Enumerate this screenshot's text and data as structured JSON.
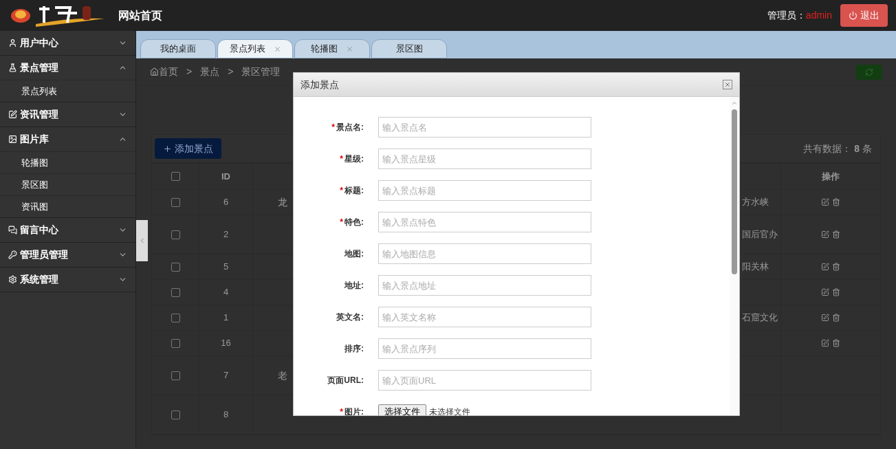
{
  "header": {
    "title": "网站首页",
    "admin_label": "管理员：",
    "admin_name": "admin",
    "logout": "退出"
  },
  "sidebar": [
    {
      "label": "用户中心",
      "expanded": false
    },
    {
      "label": "景点管理",
      "expanded": true,
      "children": [
        {
          "label": "景点列表"
        }
      ]
    },
    {
      "label": "资讯管理",
      "expanded": false
    },
    {
      "label": "图片库",
      "expanded": true,
      "children": [
        {
          "label": "轮播图"
        },
        {
          "label": "景区图"
        },
        {
          "label": "资讯图"
        }
      ]
    },
    {
      "label": "留言中心",
      "expanded": false
    },
    {
      "label": "管理员管理",
      "expanded": false
    },
    {
      "label": "系统管理",
      "expanded": false
    }
  ],
  "tabs": [
    {
      "label": "我的桌面",
      "selected": false,
      "closable": false
    },
    {
      "label": "景点列表",
      "selected": true,
      "closable": true
    },
    {
      "label": "轮播图",
      "selected": false,
      "closable": true
    },
    {
      "label": "景区图",
      "selected": false,
      "closable": false
    }
  ],
  "breadcrumb": {
    "items": [
      "首页",
      "景点",
      "景区管理"
    ],
    "separator": ">"
  },
  "toolbar": {
    "add_button": "添加景点",
    "total_label": "共有数据：",
    "total": "8",
    "total_unit": "条"
  },
  "table": {
    "select_all_checked": false,
    "columns": [
      "ID",
      "操作"
    ],
    "rows": [
      {
        "checked": false,
        "id": "6",
        "column_3": "龙",
        "column_5": "方水峡",
        "tall": false
      },
      {
        "checked": false,
        "id": "2",
        "column_3": "",
        "column_5": "国后官办",
        "tall": true
      },
      {
        "checked": false,
        "id": "5",
        "column_3": "",
        "column_5": "阳关林",
        "tall": false
      },
      {
        "checked": false,
        "id": "4",
        "column_3": "",
        "column_5": "",
        "tall": false
      },
      {
        "checked": false,
        "id": "1",
        "column_3": "",
        "column_5": "石窟文化",
        "tall": false
      },
      {
        "checked": false,
        "id": "16",
        "column_3": "",
        "column_5": "",
        "tall": false
      },
      {
        "checked": false,
        "id": "7",
        "column_3": "老",
        "column_5": "",
        "tall": true
      },
      {
        "checked": false,
        "id": "8",
        "column_3": "",
        "column_5": "",
        "tall": true
      }
    ]
  },
  "modal": {
    "title": "添加景点",
    "required_mark": "*",
    "fields": [
      {
        "kind": "text",
        "label": "景点名:",
        "required": true,
        "placeholder": "输入景点名"
      },
      {
        "kind": "text",
        "label": "星级:",
        "required": true,
        "placeholder": "输入景点星级"
      },
      {
        "kind": "text",
        "label": "标题:",
        "required": true,
        "placeholder": "输入景点标题"
      },
      {
        "kind": "text",
        "label": "特色:",
        "required": true,
        "placeholder": "输入景点特色"
      },
      {
        "kind": "text",
        "label": "地图:",
        "required": false,
        "placeholder": "输入地图信息"
      },
      {
        "kind": "text",
        "label": "地址:",
        "required": false,
        "placeholder": "输入景点地址"
      },
      {
        "kind": "text",
        "label": "英文名:",
        "required": false,
        "placeholder": "输入英文名称"
      },
      {
        "kind": "text",
        "label": "排序:",
        "required": false,
        "placeholder": "输入景点序列"
      },
      {
        "kind": "text",
        "label": "页面URL:",
        "required": false,
        "placeholder": "输入页面URL"
      },
      {
        "kind": "file",
        "label": "图片:",
        "required": true,
        "button": "选择文件",
        "status": "未选择文件"
      }
    ]
  }
}
